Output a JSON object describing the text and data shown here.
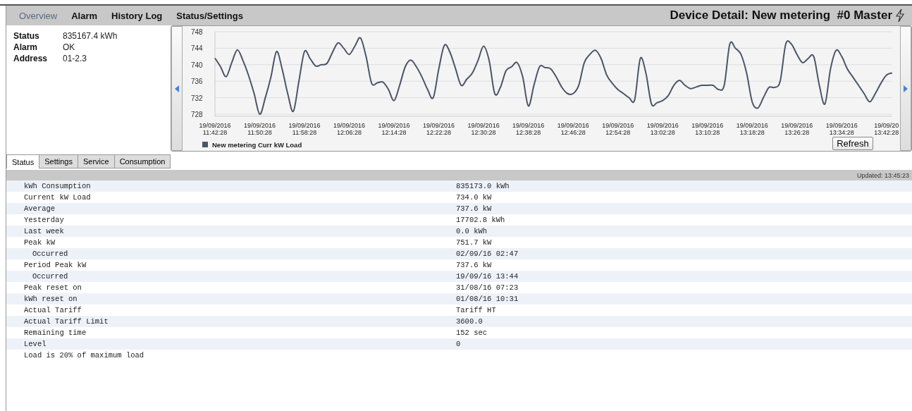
{
  "nav": {
    "items": [
      {
        "label": "Overview",
        "selected": true
      },
      {
        "label": "Alarm",
        "selected": false
      },
      {
        "label": "History Log",
        "selected": false
      },
      {
        "label": "Status/Settings",
        "selected": false
      }
    ],
    "title": "Device Detail: New metering  #0 Master"
  },
  "info": [
    {
      "label": "Status",
      "value": "835167.4 kWh"
    },
    {
      "label": "Alarm",
      "value": "OK"
    },
    {
      "label": "Address",
      "value": "01-2.3"
    }
  ],
  "chart_data": {
    "type": "line",
    "categories": [
      "19/09/2016 11:42:28",
      null,
      null,
      null,
      null,
      null,
      null,
      null,
      "19/09/2016 11:50:28",
      null,
      null,
      null,
      null,
      null,
      null,
      null,
      "19/09/2016 11:58:28",
      null,
      null,
      null,
      null,
      null,
      null,
      null,
      "19/09/2016 12:06:28",
      null,
      null,
      null,
      null,
      null,
      null,
      null,
      "19/09/2016 12:14:28",
      null,
      null,
      null,
      null,
      null,
      null,
      null,
      "19/09/2016 12:22:28",
      null,
      null,
      null,
      null,
      null,
      null,
      null,
      "19/09/2016 12:30:28",
      null,
      null,
      null,
      null,
      null,
      null,
      null,
      "19/09/2016 12:38:28",
      null,
      null,
      null,
      null,
      null,
      null,
      null,
      "19/09/2016 12:46:28",
      null,
      null,
      null,
      null,
      null,
      null,
      null,
      "19/09/2016 12:54:28",
      null,
      null,
      null,
      null,
      null,
      null,
      null,
      "19/09/2016 13:02:28",
      null,
      null,
      null,
      null,
      null,
      null,
      null,
      "19/09/2016 13:10:28",
      null,
      null,
      null,
      null,
      null,
      null,
      null,
      "19/09/2016 13:18:28",
      null,
      null,
      null,
      null,
      null,
      null,
      null,
      "19/09/2016 13:26:28",
      null,
      null,
      null,
      null,
      null,
      null,
      null,
      "19/09/2016 13:34:28",
      null,
      null,
      null,
      null,
      null,
      null,
      null,
      "19/09/20 13:42:28",
      null
    ],
    "series": [
      {
        "name": "New metering Curr kW Load",
        "color": "#4a5568",
        "values": [
          741.6,
          739.5,
          737.1,
          740.5,
          743.6,
          741,
          737.4,
          733,
          728,
          732,
          737,
          743.2,
          739,
          733,
          728.7,
          736,
          743.2,
          741.5,
          739.7,
          740,
          740.3,
          743,
          745.3,
          744,
          742.5,
          744.5,
          746.5,
          742,
          735.5,
          735.6,
          735.8,
          734,
          731.3,
          735,
          739.5,
          741.1,
          739.5,
          737,
          734,
          732,
          739,
          744.7,
          743,
          739,
          735,
          736.5,
          738,
          741,
          744.5,
          741,
          733,
          734.5,
          738.5,
          739.5,
          740.5,
          737,
          730,
          735,
          739.5,
          739.3,
          739,
          737,
          734.5,
          733,
          733,
          735,
          740.5,
          742.5,
          743.5,
          741.5,
          737.5,
          735.5,
          734,
          733,
          732,
          731.5,
          741.5,
          738,
          730.5,
          730.8,
          731.3,
          732.5,
          735,
          736.2,
          735,
          734.2,
          734.6,
          735,
          735,
          735,
          734,
          735,
          745,
          744,
          742.5,
          738,
          731,
          729.5,
          732,
          734.5,
          734.5,
          736,
          745,
          745,
          742.5,
          740.5,
          741.5,
          742,
          735,
          730.5,
          739,
          743.5,
          742,
          739,
          737,
          735,
          733,
          731,
          733,
          735.5,
          737.5,
          738
        ]
      }
    ],
    "ylim": [
      728,
      748
    ],
    "yticks": [
      728,
      732,
      736,
      740,
      744,
      748
    ],
    "grid": true
  },
  "refresh_button": "Refresh",
  "detail_tabs": [
    {
      "label": "Status",
      "selected": true
    },
    {
      "label": "Settings",
      "selected": false
    },
    {
      "label": "Service",
      "selected": false
    },
    {
      "label": "Consumption",
      "selected": false
    }
  ],
  "updated": "Updated: 13:45:23",
  "rows": [
    {
      "label": "kWh Consumption",
      "value": "835173.0 kWh"
    },
    {
      "label": "Current kW Load",
      "value": "734.0 kW"
    },
    {
      "label": "Average",
      "value": "737.6 kW"
    },
    {
      "label": "Yesterday",
      "value": "17702.8 kWh"
    },
    {
      "label": "Last week",
      "value": "0.0 kWh"
    },
    {
      "label": "Peak kW",
      "value": "751.7 kW",
      "children": [
        {
          "label": "Occurred",
          "value": "02/09/16 02:47"
        }
      ]
    },
    {
      "label": "Period Peak kW",
      "value": "737.6 kW",
      "children": [
        {
          "label": "Occurred",
          "value": "19/09/16 13:44"
        }
      ]
    },
    {
      "label": "Peak reset on",
      "value": "31/08/16 07:23"
    },
    {
      "label": "kWh reset on",
      "value": "01/08/16 10:31"
    },
    {
      "label": "Actual Tariff",
      "value": "Tariff HT"
    },
    {
      "label": "Actual Tariff Limit",
      "value": "3600.0"
    },
    {
      "label": "Remaining time",
      "value": "152 sec"
    },
    {
      "label": "Level",
      "value": "0"
    },
    {
      "label": "Load is 20% of maximum load"
    }
  ]
}
